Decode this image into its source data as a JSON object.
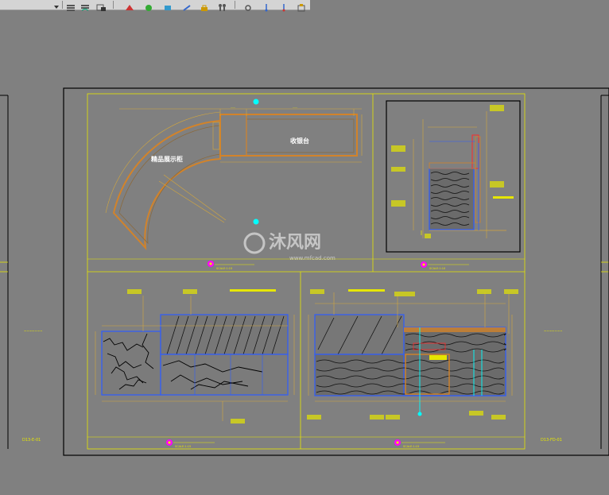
{
  "colors": {
    "background": "#808080",
    "paper_border": "#000000",
    "frame": "#e6e600",
    "dimension": "#d4a73c",
    "orange": "#d2832a",
    "wood": "#8b6a3d",
    "cyan": "#00ffff",
    "magenta": "#ff00ff",
    "blue": "#2d5cff",
    "red": "#ff2a2a",
    "black": "#000000",
    "hatch": "#1a1a1a"
  },
  "toolbar": {
    "icons": [
      "layer-icon",
      "layer-prev-icon",
      "layer-state-icon",
      "match-icon",
      "isolate-icon",
      "unisolate-icon",
      "freeze-icon",
      "lock-icon",
      "walk-icon",
      "gear-icon",
      "pin-icon",
      "pin2-icon",
      "text-icon"
    ]
  },
  "plan": {
    "label_showcase": "精品展示柜",
    "label_counter": "收银台",
    "scale_text": "SCALE:1:15"
  },
  "section": {
    "scale_text": "SCALE:1:10"
  },
  "elev_left": {
    "scale_text": "SCALE:1:15"
  },
  "elev_right": {
    "scale_text": "SCALE:1:15"
  },
  "side_left": {
    "code": "D13-E-01"
  },
  "side_right": {
    "code": "D13-FD-01"
  },
  "watermark": {
    "brand": "沐风网",
    "url": "www.mfcad.com"
  }
}
